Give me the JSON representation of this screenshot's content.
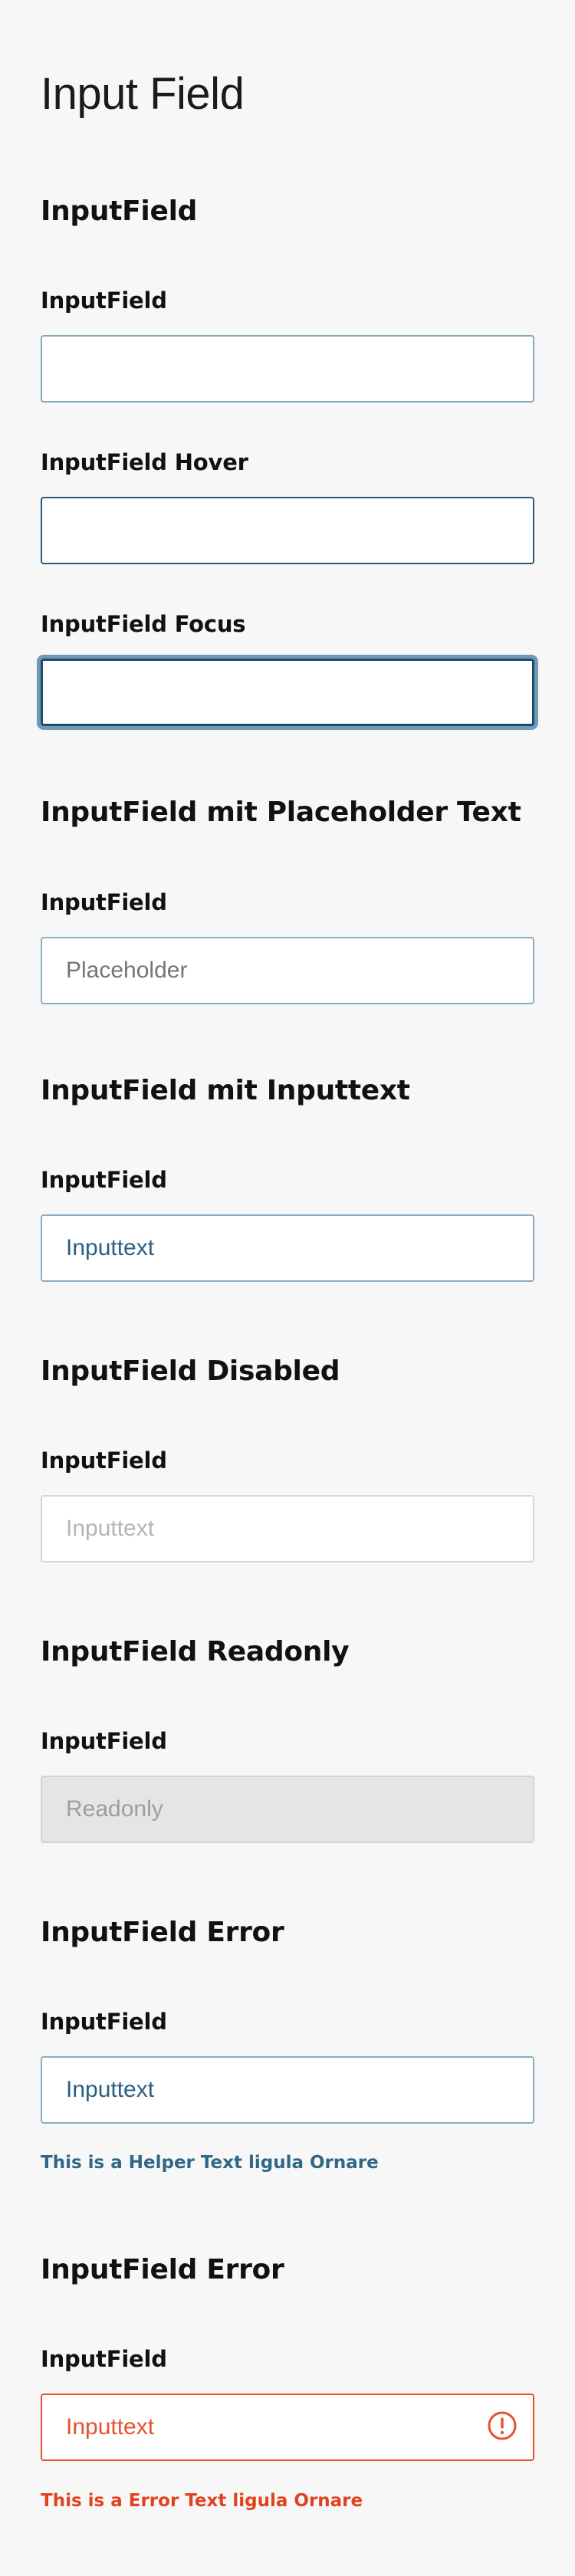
{
  "page": {
    "title": "Input Field"
  },
  "sections": [
    {
      "title": "InputField",
      "fields": [
        {
          "label": "InputField",
          "state": "default",
          "value": ""
        },
        {
          "label": "InputField Hover",
          "state": "hover",
          "value": ""
        },
        {
          "label": "InputField Focus",
          "state": "focus",
          "value": ""
        }
      ]
    },
    {
      "title": "InputField mit Placeholder Text",
      "fields": [
        {
          "label": "InputField",
          "state": "placeholder",
          "placeholder": "Placeholder",
          "value": ""
        }
      ]
    },
    {
      "title": "InputField mit Inputtext",
      "fields": [
        {
          "label": "InputField",
          "state": "filled",
          "value": "Inputtext"
        }
      ]
    },
    {
      "title": "InputField Disabled",
      "fields": [
        {
          "label": "InputField",
          "state": "disabled",
          "value": "Inputtext"
        }
      ]
    },
    {
      "title": "InputField Readonly",
      "fields": [
        {
          "label": "InputField",
          "state": "readonly",
          "value": "Readonly"
        }
      ]
    },
    {
      "title": "InputField Error",
      "fields": [
        {
          "label": "InputField",
          "state": "helper",
          "value": "Inputtext",
          "helper": "This is a Helper Text ligula Ornare"
        }
      ]
    },
    {
      "title": "InputField Error",
      "fields": [
        {
          "label": "InputField",
          "state": "error",
          "value": "Inputtext",
          "error": "This is a Error Text ligula Ornare",
          "icon": "error-circle-icon"
        }
      ]
    }
  ],
  "colors": {
    "background": "#f7f7f8",
    "border_default": "#83a9b9",
    "border_hover": "#2b5a78",
    "focus_ring": "#6f99b6",
    "input_text": "#2c5f84",
    "placeholder_text": "#a6a6a6",
    "disabled_border": "#d7d7d7",
    "readonly_background": "#e5e5e5",
    "helper_text": "#2f6786",
    "error": "#e6512f"
  }
}
